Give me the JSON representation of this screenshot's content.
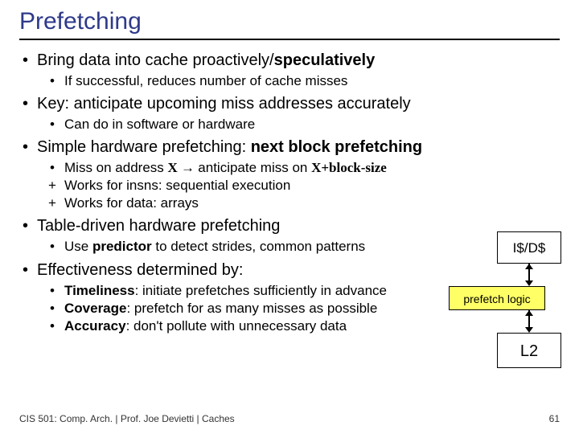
{
  "title": "Prefetching",
  "b1": {
    "pre": "Bring data into cache proactively/",
    "bold": "speculatively",
    "s1": "If successful, reduces number of cache misses"
  },
  "b2": {
    "text": "Key: anticipate upcoming miss addresses accurately",
    "s1": "Can do in software or hardware"
  },
  "b3": {
    "pre": "Simple hardware prefetching: ",
    "bold": "next block prefetching",
    "s1a": "Miss on address ",
    "s1x": "X",
    "s1arr": " → ",
    "s1b": "anticipate miss on ",
    "s1y": "X+block-size",
    "s2": "Works for insns: sequential execution",
    "s3": "Works for data: arrays"
  },
  "b4": {
    "text": "Table-driven hardware prefetching",
    "s1a": "Use ",
    "s1b": "predictor",
    "s1c": " to detect strides, common patterns"
  },
  "b5": {
    "text": "Effectiveness determined by:",
    "s1a": "Timeliness",
    "s1b": ": initiate prefetches sufficiently in advance",
    "s2a": "Coverage",
    "s2b": ": prefetch for as many misses as possible",
    "s3a": "Accuracy",
    "s3b": ": don't pollute with unnecessary data"
  },
  "diagram": {
    "top": "I$/D$",
    "mid": "prefetch logic",
    "bot": "L2"
  },
  "footer": "CIS 501: Comp. Arch.  |  Prof. Joe Devietti  |  Caches",
  "page": "61"
}
